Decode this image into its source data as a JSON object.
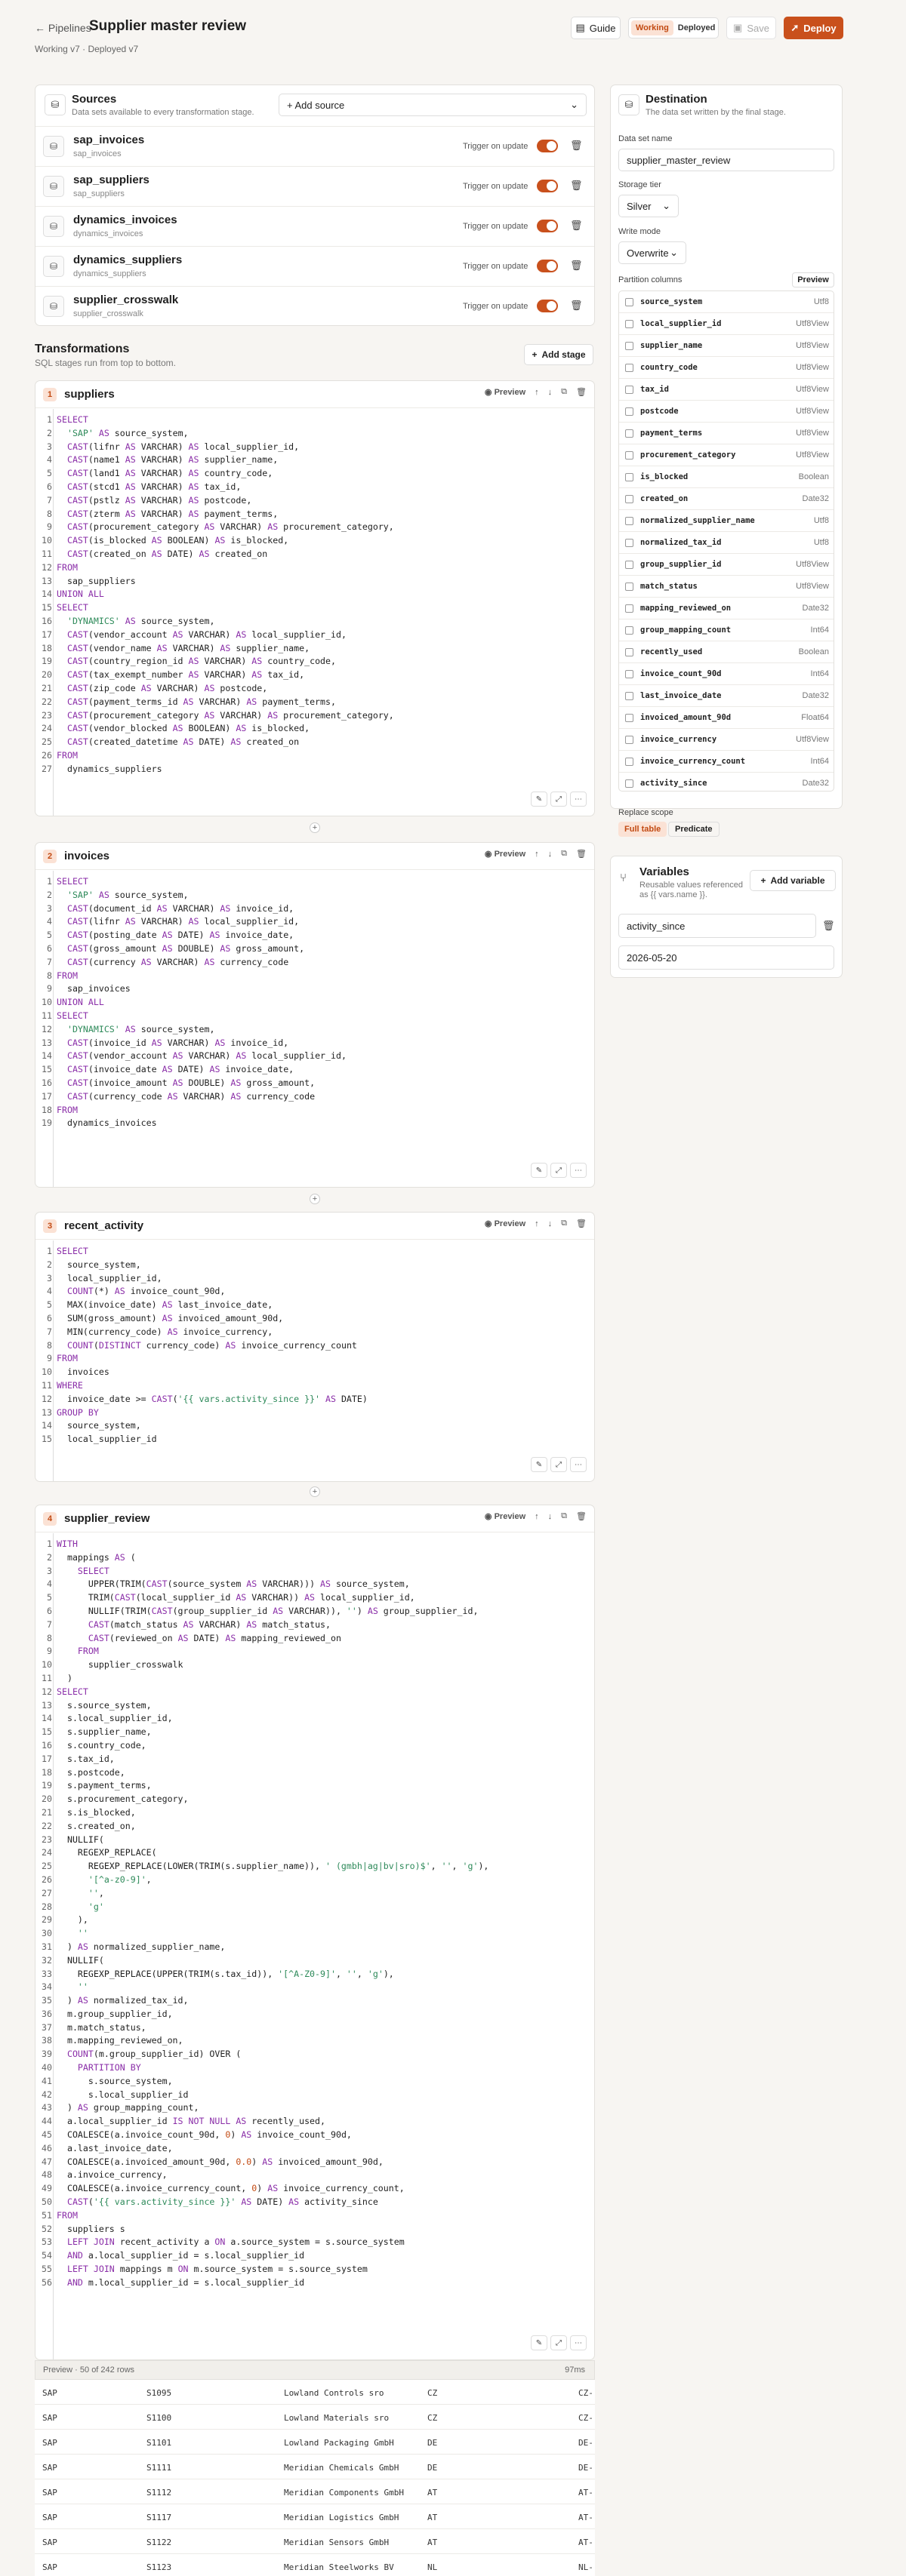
{
  "header": {
    "back_label": "← Pipelines",
    "title": "Supplier master review",
    "subtitle": "Working v7 · Deployed v7",
    "guide_label": "Guide",
    "status_working": "Working",
    "status_deployed": "Deployed",
    "save_label": "Save",
    "deploy_label": "Deploy"
  },
  "sources": {
    "title": "Sources",
    "subtitle": "Data sets available to every transformation stage.",
    "add_source_label": "+ Add source",
    "trigger_label": "Trigger on update",
    "items": [
      {
        "name": "sap_invoices",
        "sub": "sap_invoices"
      },
      {
        "name": "sap_suppliers",
        "sub": "sap_suppliers"
      },
      {
        "name": "dynamics_invoices",
        "sub": "dynamics_invoices"
      },
      {
        "name": "dynamics_suppliers",
        "sub": "dynamics_suppliers"
      },
      {
        "name": "supplier_crosswalk",
        "sub": "supplier_crosswalk"
      }
    ]
  },
  "transformations": {
    "title": "Transformations",
    "subtitle": "SQL stages run from top to bottom.",
    "add_stage_label": "Add stage",
    "preview_label": "Preview",
    "stages": [
      {
        "num": "1",
        "name": "suppliers",
        "line_count": 27
      },
      {
        "num": "2",
        "name": "invoices",
        "line_count": 19
      },
      {
        "num": "3",
        "name": "recent_activity",
        "line_count": 15
      },
      {
        "num": "4",
        "name": "supplier_review",
        "line_count": 56
      }
    ]
  },
  "preview": {
    "label": "Preview · 50 of 242 rows",
    "time": "97ms",
    "rows": [
      [
        "SAP",
        "S1095",
        "Lowland Controls sro",
        "CZ",
        "CZ-"
      ],
      [
        "SAP",
        "S1100",
        "Lowland Materials sro",
        "CZ",
        "CZ-"
      ],
      [
        "SAP",
        "S1101",
        "Lowland Packaging GmbH",
        "DE",
        "DE-"
      ],
      [
        "SAP",
        "S1111",
        "Meridian Chemicals GmbH",
        "DE",
        "DE-"
      ],
      [
        "SAP",
        "S1112",
        "Meridian Components GmbH",
        "AT",
        "AT-"
      ],
      [
        "SAP",
        "S1117",
        "Meridian Logistics GmbH",
        "AT",
        "AT-"
      ],
      [
        "SAP",
        "S1122",
        "Meridian Sensors GmbH",
        "AT",
        "AT-"
      ],
      [
        "SAP",
        "S1123",
        "Meridian Steelworks BV",
        "NL",
        "NL-"
      ]
    ]
  },
  "destination": {
    "title": "Destination",
    "subtitle": "The data set written by the final stage.",
    "dataset_label": "Data set name",
    "dataset_value": "supplier_master_review",
    "tier_label": "Storage tier",
    "tier_value": "Silver",
    "write_label": "Write mode",
    "write_value": "Overwrite",
    "partition_label": "Partition columns",
    "preview_label": "Preview",
    "columns": [
      {
        "name": "source_system",
        "type": "Utf8"
      },
      {
        "name": "local_supplier_id",
        "type": "Utf8View"
      },
      {
        "name": "supplier_name",
        "type": "Utf8View"
      },
      {
        "name": "country_code",
        "type": "Utf8View"
      },
      {
        "name": "tax_id",
        "type": "Utf8View"
      },
      {
        "name": "postcode",
        "type": "Utf8View"
      },
      {
        "name": "payment_terms",
        "type": "Utf8View"
      },
      {
        "name": "procurement_category",
        "type": "Utf8View"
      },
      {
        "name": "is_blocked",
        "type": "Boolean"
      },
      {
        "name": "created_on",
        "type": "Date32"
      },
      {
        "name": "normalized_supplier_name",
        "type": "Utf8"
      },
      {
        "name": "normalized_tax_id",
        "type": "Utf8"
      },
      {
        "name": "group_supplier_id",
        "type": "Utf8View"
      },
      {
        "name": "match_status",
        "type": "Utf8View"
      },
      {
        "name": "mapping_reviewed_on",
        "type": "Date32"
      },
      {
        "name": "group_mapping_count",
        "type": "Int64"
      },
      {
        "name": "recently_used",
        "type": "Boolean"
      },
      {
        "name": "invoice_count_90d",
        "type": "Int64"
      },
      {
        "name": "last_invoice_date",
        "type": "Date32"
      },
      {
        "name": "invoiced_amount_90d",
        "type": "Float64"
      },
      {
        "name": "invoice_currency",
        "type": "Utf8View"
      },
      {
        "name": "invoice_currency_count",
        "type": "Int64"
      },
      {
        "name": "activity_since",
        "type": "Date32"
      }
    ],
    "replace_label": "Replace scope",
    "scope_full": "Full table",
    "scope_predicate": "Predicate"
  },
  "variables": {
    "title": "Variables",
    "subtitle": "Reusable values referenced as {{ vars.name }}.",
    "add_label": "Add variable",
    "name_value": "activity_since",
    "value_value": "2026-05-20"
  },
  "icons": {
    "database": "database-icon",
    "trash": "trash-icon",
    "eye": "eye-icon",
    "copy": "copy-icon",
    "plus": "plus-icon"
  },
  "colors": {
    "accent": "#c9501c",
    "accent_soft": "#fbe2d5",
    "keyword": "#8a2ea8",
    "string": "#2e8a5a"
  }
}
